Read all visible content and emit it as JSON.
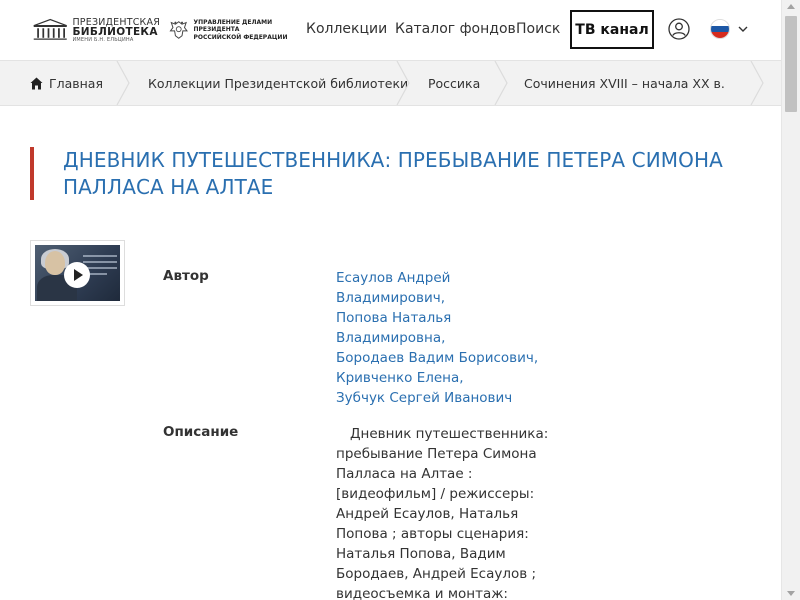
{
  "header": {
    "library_logo": {
      "line1": "ПРЕЗИДЕНТСКАЯ",
      "line2": "БИБЛИОТЕКА",
      "line3": "ИМЕНИ Б.Н. ЕЛЬЦИНА"
    },
    "admin_logo": {
      "line1": "УПРАВЛЕНИЕ ДЕЛАМИ ПРЕЗИДЕНТА",
      "line2": "РОССИЙСКОЙ ФЕДЕРАЦИИ"
    },
    "nav": [
      "Коллекции",
      "Каталог фондов",
      "Поиск"
    ],
    "tv_button": "ТВ канал",
    "user_icon": "user-icon",
    "language_icon": "russia-flag-icon",
    "language_dropdown_icon": "chevron-down-icon"
  },
  "breadcrumb": [
    {
      "label": "Главная",
      "icon": "home-icon"
    },
    {
      "label": "Коллекции Президентской библиотеки"
    },
    {
      "label": "Россика"
    },
    {
      "label": "Сочинения XVIII – начала XX в."
    }
  ],
  "page": {
    "title": "ДНЕВНИК ПУТЕШЕСТВЕННИКА: ПРЕБЫВАНИЕ ПЕТЕРА СИМОНА ПАЛЛАСА НА АЛТАЕ",
    "thumbnail_icon": "play-icon"
  },
  "fields": {
    "author_label": "Автор",
    "authors": [
      "Есаулов Андрей Владимирович,",
      "Попова Наталья Владимировна,",
      "Бородаев Вадим Борисович,",
      "Кривченко Елена,",
      "Зубчук Сергей Иванович"
    ],
    "description_label": "Описание",
    "description": "Дневник путешественника: пребывание Петера Симона Палласа на Алтае : [видеофильм] / режиссеры: Андрей Есаулов, Наталья Попова ; авторы сценария: Наталья Попова, Вадим Бородаев, Андрей Есаулов ; видеосъемка и монтаж: Андрей"
  },
  "colors": {
    "link": "#2a6fb0",
    "accent_bar": "#c0392b",
    "breadcrumb_bg": "#f2f2f2",
    "flag": [
      "#ffffff",
      "#1c57a5",
      "#d52b1e"
    ]
  }
}
